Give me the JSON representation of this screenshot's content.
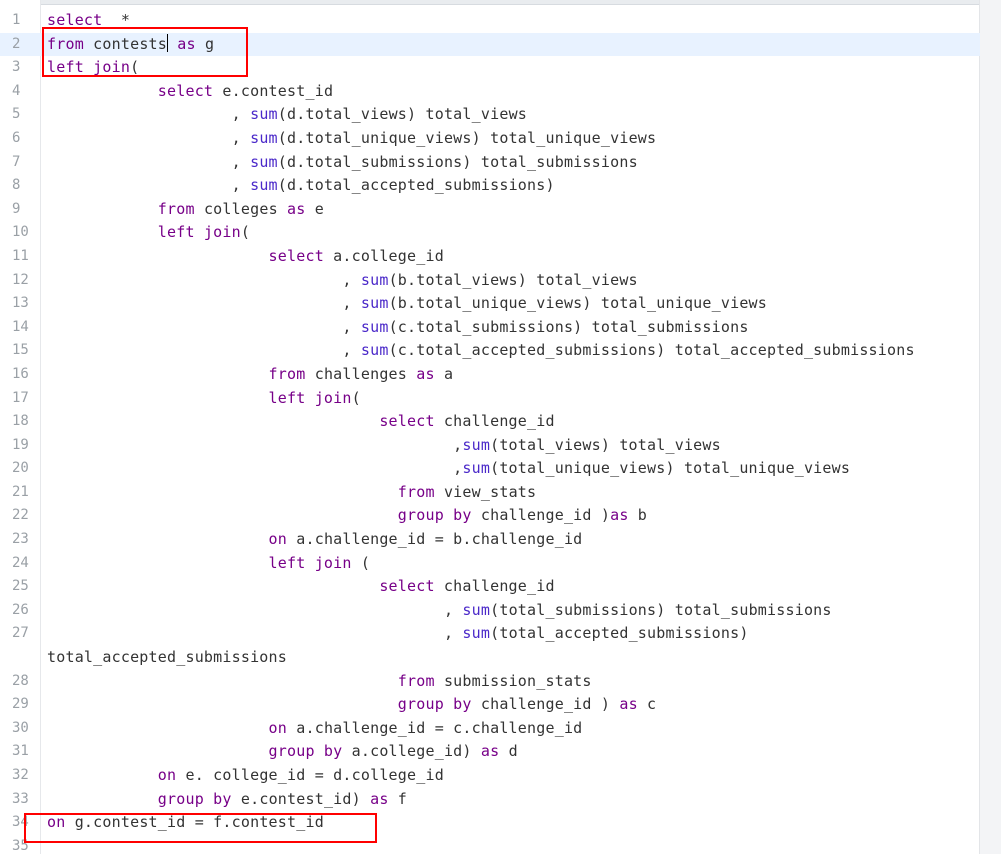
{
  "colors": {
    "keyword": "#770088",
    "function": "#4a28c9",
    "text": "#333333",
    "active_line": "#e8f2ff",
    "annotation_box": "#ff0000"
  },
  "editor": {
    "lines": [
      {
        "n": "1",
        "segs": [
          [
            "kw",
            "select"
          ],
          [
            "",
            "  *"
          ]
        ]
      },
      {
        "n": "2",
        "segs": [
          [
            "kw",
            "from"
          ],
          [
            "",
            " contests"
          ],
          [
            "cursor",
            ""
          ],
          [
            "",
            " "
          ],
          [
            "kw",
            "as"
          ],
          [
            "",
            " g"
          ]
        ]
      },
      {
        "n": "3",
        "segs": [
          [
            "kw",
            "left join"
          ],
          [
            "",
            "("
          ]
        ]
      },
      {
        "n": "4",
        "segs": [
          [
            "",
            "            "
          ],
          [
            "kw",
            "select"
          ],
          [
            "",
            " e.contest_id"
          ]
        ]
      },
      {
        "n": "5",
        "segs": [
          [
            "",
            "                    , "
          ],
          [
            "fn",
            "sum"
          ],
          [
            "",
            "(d.total_views) total_views"
          ]
        ]
      },
      {
        "n": "6",
        "segs": [
          [
            "",
            "                    , "
          ],
          [
            "fn",
            "sum"
          ],
          [
            "",
            "(d.total_unique_views) total_unique_views"
          ]
        ]
      },
      {
        "n": "7",
        "segs": [
          [
            "",
            "                    , "
          ],
          [
            "fn",
            "sum"
          ],
          [
            "",
            "(d.total_submissions) total_submissions"
          ]
        ]
      },
      {
        "n": "8",
        "segs": [
          [
            "",
            "                    , "
          ],
          [
            "fn",
            "sum"
          ],
          [
            "",
            "(d.total_accepted_submissions)"
          ]
        ]
      },
      {
        "n": "9",
        "segs": [
          [
            "",
            "            "
          ],
          [
            "kw",
            "from"
          ],
          [
            "",
            " colleges "
          ],
          [
            "kw",
            "as"
          ],
          [
            "",
            " e"
          ]
        ]
      },
      {
        "n": "10",
        "segs": [
          [
            "",
            "            "
          ],
          [
            "kw",
            "left join"
          ],
          [
            "",
            "("
          ]
        ]
      },
      {
        "n": "11",
        "segs": [
          [
            "",
            "                        "
          ],
          [
            "kw",
            "select"
          ],
          [
            "",
            " a.college_id"
          ]
        ]
      },
      {
        "n": "12",
        "segs": [
          [
            "",
            "                                , "
          ],
          [
            "fn",
            "sum"
          ],
          [
            "",
            "(b.total_views) total_views"
          ]
        ]
      },
      {
        "n": "13",
        "segs": [
          [
            "",
            "                                , "
          ],
          [
            "fn",
            "sum"
          ],
          [
            "",
            "(b.total_unique_views) total_unique_views"
          ]
        ]
      },
      {
        "n": "14",
        "segs": [
          [
            "",
            "                                , "
          ],
          [
            "fn",
            "sum"
          ],
          [
            "",
            "(c.total_submissions) total_submissions"
          ]
        ]
      },
      {
        "n": "15",
        "segs": [
          [
            "",
            "                                , "
          ],
          [
            "fn",
            "sum"
          ],
          [
            "",
            "(c.total_accepted_submissions) total_accepted_submissions"
          ]
        ]
      },
      {
        "n": "16",
        "segs": [
          [
            "",
            "                        "
          ],
          [
            "kw",
            "from"
          ],
          [
            "",
            " challenges "
          ],
          [
            "kw",
            "as"
          ],
          [
            "",
            " a"
          ]
        ]
      },
      {
        "n": "17",
        "segs": [
          [
            "",
            "                        "
          ],
          [
            "kw",
            "left join"
          ],
          [
            "",
            "("
          ]
        ]
      },
      {
        "n": "18",
        "segs": [
          [
            "",
            "                                    "
          ],
          [
            "kw",
            "select"
          ],
          [
            "",
            " challenge_id"
          ]
        ]
      },
      {
        "n": "19",
        "segs": [
          [
            "",
            "                                            ,"
          ],
          [
            "fn",
            "sum"
          ],
          [
            "",
            "(total_views) total_views"
          ]
        ]
      },
      {
        "n": "20",
        "segs": [
          [
            "",
            "                                            ,"
          ],
          [
            "fn",
            "sum"
          ],
          [
            "",
            "(total_unique_views) total_unique_views"
          ]
        ]
      },
      {
        "n": "21",
        "segs": [
          [
            "",
            "                                      "
          ],
          [
            "kw",
            "from"
          ],
          [
            "",
            " view_stats"
          ]
        ]
      },
      {
        "n": "22",
        "segs": [
          [
            "",
            "                                      "
          ],
          [
            "kw",
            "group by"
          ],
          [
            "",
            " challenge_id )"
          ],
          [
            "kw",
            "as"
          ],
          [
            "",
            " b"
          ]
        ]
      },
      {
        "n": "23",
        "segs": [
          [
            "",
            "                        "
          ],
          [
            "kw",
            "on"
          ],
          [
            "",
            " a.challenge_id = b.challenge_id"
          ]
        ]
      },
      {
        "n": "24",
        "segs": [
          [
            "",
            "                        "
          ],
          [
            "kw",
            "left join"
          ],
          [
            "",
            " ("
          ]
        ]
      },
      {
        "n": "25",
        "segs": [
          [
            "",
            "                                    "
          ],
          [
            "kw",
            "select"
          ],
          [
            "",
            " challenge_id"
          ]
        ]
      },
      {
        "n": "26",
        "segs": [
          [
            "",
            "                                           , "
          ],
          [
            "fn",
            "sum"
          ],
          [
            "",
            "(total_submissions) total_submissions"
          ]
        ]
      },
      {
        "n": "27",
        "wrapped": true,
        "segs": [
          [
            "",
            "                                           , "
          ],
          [
            "fn",
            "sum"
          ],
          [
            "",
            "(total_accepted_submissions)\ntotal_accepted_submissions"
          ]
        ]
      },
      {
        "n": "28",
        "segs": [
          [
            "",
            "                                      "
          ],
          [
            "kw",
            "from"
          ],
          [
            "",
            " submission_stats"
          ]
        ]
      },
      {
        "n": "29",
        "segs": [
          [
            "",
            "                                      "
          ],
          [
            "kw",
            "group by"
          ],
          [
            "",
            " challenge_id ) "
          ],
          [
            "kw",
            "as"
          ],
          [
            "",
            " c"
          ]
        ]
      },
      {
        "n": "30",
        "segs": [
          [
            "",
            "                        "
          ],
          [
            "kw",
            "on"
          ],
          [
            "",
            " a.challenge_id = c.challenge_id"
          ]
        ]
      },
      {
        "n": "31",
        "segs": [
          [
            "",
            "                        "
          ],
          [
            "kw",
            "group by"
          ],
          [
            "",
            " a.college_id) "
          ],
          [
            "kw",
            "as"
          ],
          [
            "",
            " d"
          ]
        ]
      },
      {
        "n": "32",
        "segs": [
          [
            "",
            "            "
          ],
          [
            "kw",
            "on"
          ],
          [
            "",
            " e. college_id = d.college_id"
          ]
        ]
      },
      {
        "n": "33",
        "segs": [
          [
            "",
            "            "
          ],
          [
            "kw",
            "group by"
          ],
          [
            "",
            " e.contest_id) "
          ],
          [
            "kw",
            "as"
          ],
          [
            "",
            " f"
          ]
        ]
      },
      {
        "n": "34",
        "segs": [
          [
            "kw",
            "on"
          ],
          [
            "",
            " g.contest_id = f.contest_id"
          ]
        ]
      },
      {
        "n": "35",
        "segs": []
      }
    ]
  }
}
